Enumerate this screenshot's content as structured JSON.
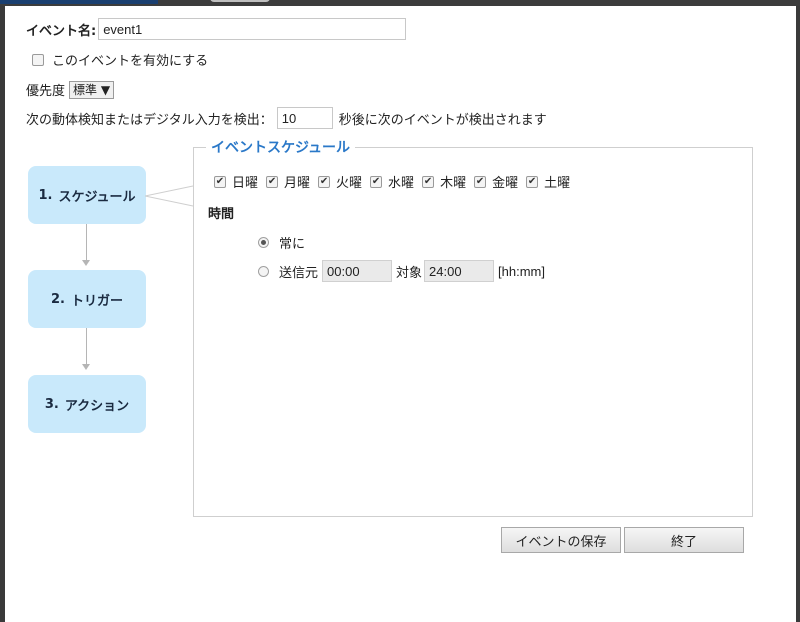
{
  "event_name": {
    "label": "イベント名:",
    "value": "event1"
  },
  "enable": {
    "label": "このイベントを有効にする",
    "checked": false
  },
  "priority": {
    "label": "優先度",
    "value": "標準 ▼"
  },
  "detection": {
    "prefix": "次の動体検知またはデジタル入力を検出：",
    "value": "10",
    "suffix": "秒後に次のイベントが検出されます"
  },
  "steps": [
    {
      "number": "1.",
      "label": "スケジュール"
    },
    {
      "number": "2.",
      "label": "トリガー"
    },
    {
      "number": "3.",
      "label": "アクション"
    }
  ],
  "schedule": {
    "title": "イベントスケジュール",
    "days": [
      {
        "label": "日曜",
        "checked": true
      },
      {
        "label": "月曜",
        "checked": true
      },
      {
        "label": "火曜",
        "checked": true
      },
      {
        "label": "水曜",
        "checked": true
      },
      {
        "label": "木曜",
        "checked": true
      },
      {
        "label": "金曜",
        "checked": true
      },
      {
        "label": "土曜",
        "checked": true
      }
    ],
    "time_label": "時間",
    "always_label": "常に",
    "from_label": "送信元",
    "from_value": "00:00",
    "to_label": "対象",
    "to_value": "24:00",
    "format": "[hh:mm]"
  },
  "buttons": {
    "save": "イベントの保存",
    "close": "終了"
  },
  "check_mark": "✔",
  "colors": {
    "accent": "#2a78c8",
    "step_bg": "#c9e9fb"
  }
}
